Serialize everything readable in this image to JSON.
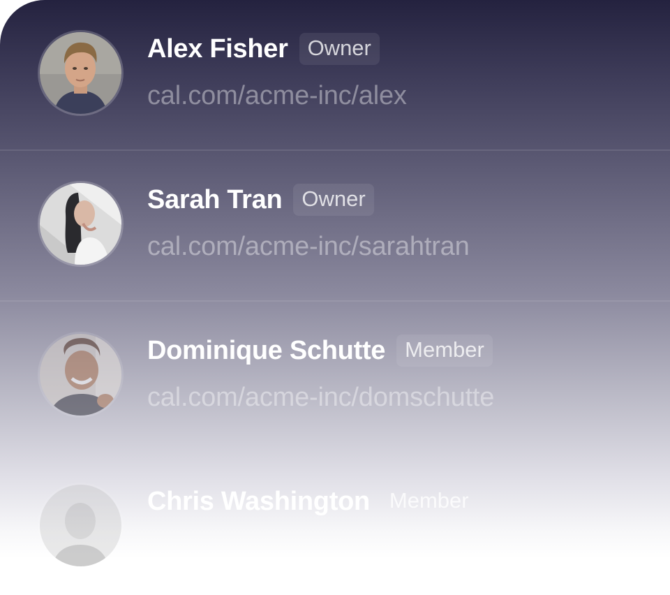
{
  "members": [
    {
      "name": "Alex Fisher",
      "role": "Owner",
      "url": "cal.com/acme-inc/alex",
      "avatar_icon": "person-photo-icon"
    },
    {
      "name": "Sarah Tran",
      "role": "Owner",
      "url": "cal.com/acme-inc/sarahtran",
      "avatar_icon": "person-photo-icon"
    },
    {
      "name": "Dominique Schutte",
      "role": "Member",
      "url": "cal.com/acme-inc/domschutte",
      "avatar_icon": "person-photo-icon"
    },
    {
      "name": "Chris Washington",
      "role": "Member",
      "url": "",
      "avatar_icon": "person-photo-icon"
    }
  ]
}
